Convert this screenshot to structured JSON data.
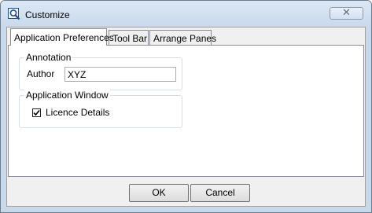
{
  "window": {
    "title": "Customize",
    "icon": "magnifier-icon",
    "close_glyph": "✕"
  },
  "tabs": [
    {
      "label": "Application Preferences",
      "active": true
    },
    {
      "label": "Tool Bar",
      "active": false
    },
    {
      "label": "Arrange Panes",
      "active": false
    }
  ],
  "annotation_group": {
    "legend": "Annotation",
    "author_label": "Author",
    "author_value": "XYZ"
  },
  "application_window_group": {
    "legend": "Application Window",
    "licence_details_label": "Licence Details",
    "licence_details_checked": true
  },
  "buttons": {
    "ok_label": "OK",
    "cancel_label": "Cancel"
  }
}
